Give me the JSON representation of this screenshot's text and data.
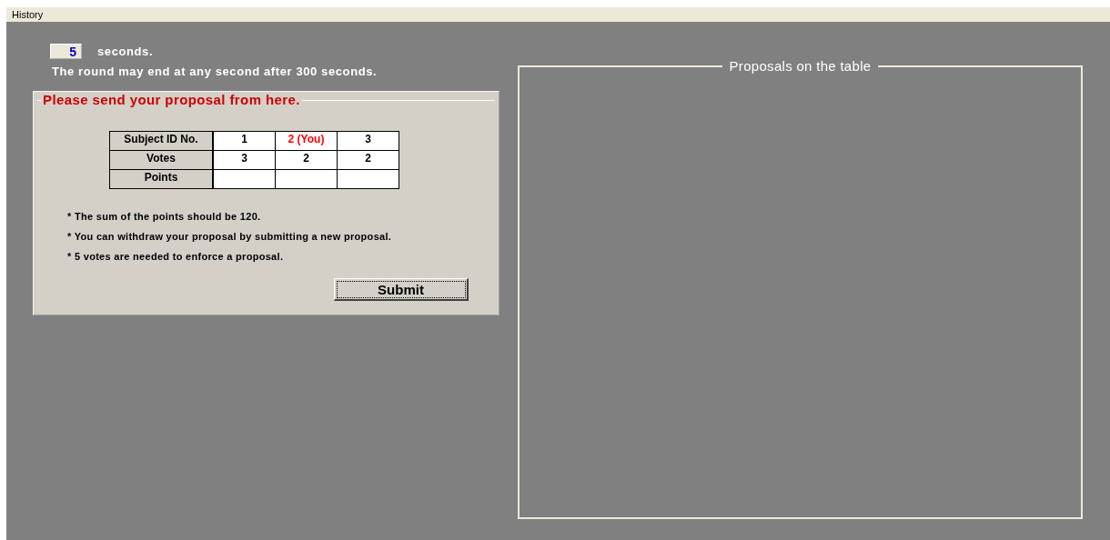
{
  "menu": {
    "label": "History"
  },
  "timer": {
    "value": "5",
    "unit": "seconds."
  },
  "round_notice": "The round may end at any second after 300 seconds.",
  "proposal_panel": {
    "title": "Please send your proposal from here.",
    "row_labels": [
      "Subject ID No.",
      "Votes",
      "Points"
    ],
    "subjects": [
      {
        "id": "1",
        "votes": "3",
        "you": false
      },
      {
        "id": "2 (You)",
        "votes": "2",
        "you": true
      },
      {
        "id": "3",
        "votes": "2",
        "you": false
      }
    ],
    "notes": [
      "* The sum of the points should be 120.",
      "* You can withdraw your proposal by submitting a new proposal.",
      "* 5 votes are needed to enforce a proposal."
    ],
    "submit": "Submit"
  },
  "table_panel": {
    "title": "Proposals on the table"
  }
}
